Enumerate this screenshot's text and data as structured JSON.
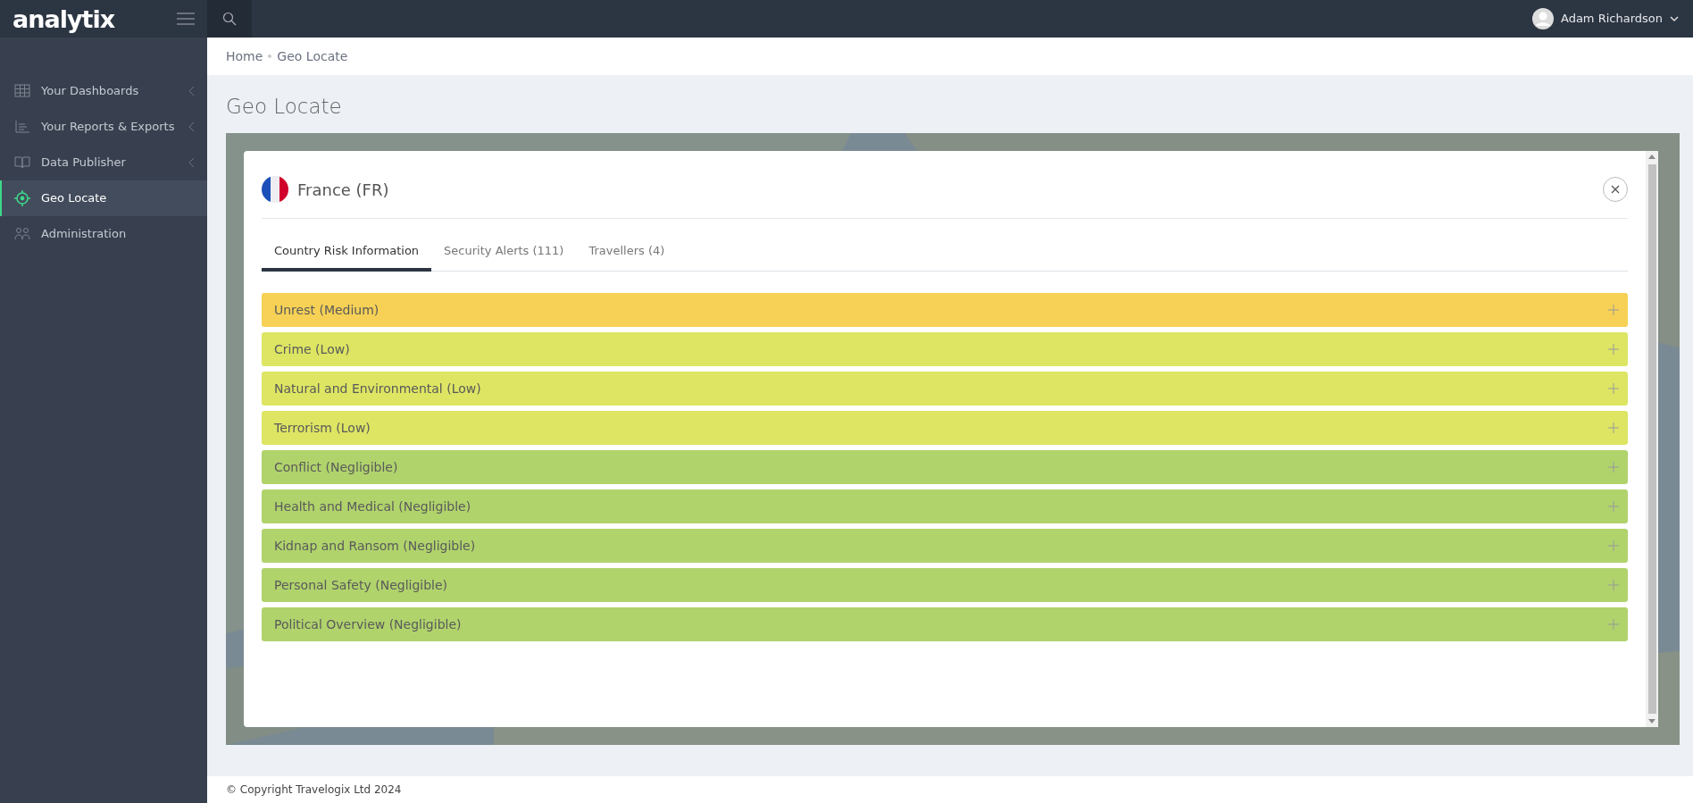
{
  "brand": "analytix",
  "user": {
    "name": "Adam Richardson"
  },
  "sidebar": {
    "items": [
      {
        "label": "Your Dashboards",
        "expandable": true,
        "selected": false
      },
      {
        "label": "Your Reports & Exports",
        "expandable": true,
        "selected": false
      },
      {
        "label": "Data Publisher",
        "expandable": true,
        "selected": false
      },
      {
        "label": "Geo Locate",
        "expandable": false,
        "selected": true
      },
      {
        "label": "Administration",
        "expandable": false,
        "selected": false
      }
    ]
  },
  "breadcrumb": [
    "Home",
    "Geo Locate"
  ],
  "page_title": "Geo Locate",
  "modal": {
    "title": "France (FR)",
    "tabs": [
      {
        "label": "Country Risk Information",
        "selected": true
      },
      {
        "label": "Security Alerts (111)",
        "selected": false
      },
      {
        "label": "Travellers (4)",
        "selected": false
      }
    ],
    "risks": [
      {
        "label": "Unrest (Medium)",
        "color": "#f6d155"
      },
      {
        "label": "Crime (Low)",
        "color": "#dde563"
      },
      {
        "label": "Natural and Environmental (Low)",
        "color": "#dde563"
      },
      {
        "label": "Terrorism (Low)",
        "color": "#dde563"
      },
      {
        "label": "Conflict (Negligible)",
        "color": "#b0d36c"
      },
      {
        "label": "Health and Medical (Negligible)",
        "color": "#b0d36c"
      },
      {
        "label": "Kidnap and Ransom (Negligible)",
        "color": "#b0d36c"
      },
      {
        "label": "Personal Safety (Negligible)",
        "color": "#b0d36c"
      },
      {
        "label": "Political Overview (Negligible)",
        "color": "#b0d36c"
      }
    ]
  },
  "footer": "© Copyright Travelogix Ltd 2024"
}
